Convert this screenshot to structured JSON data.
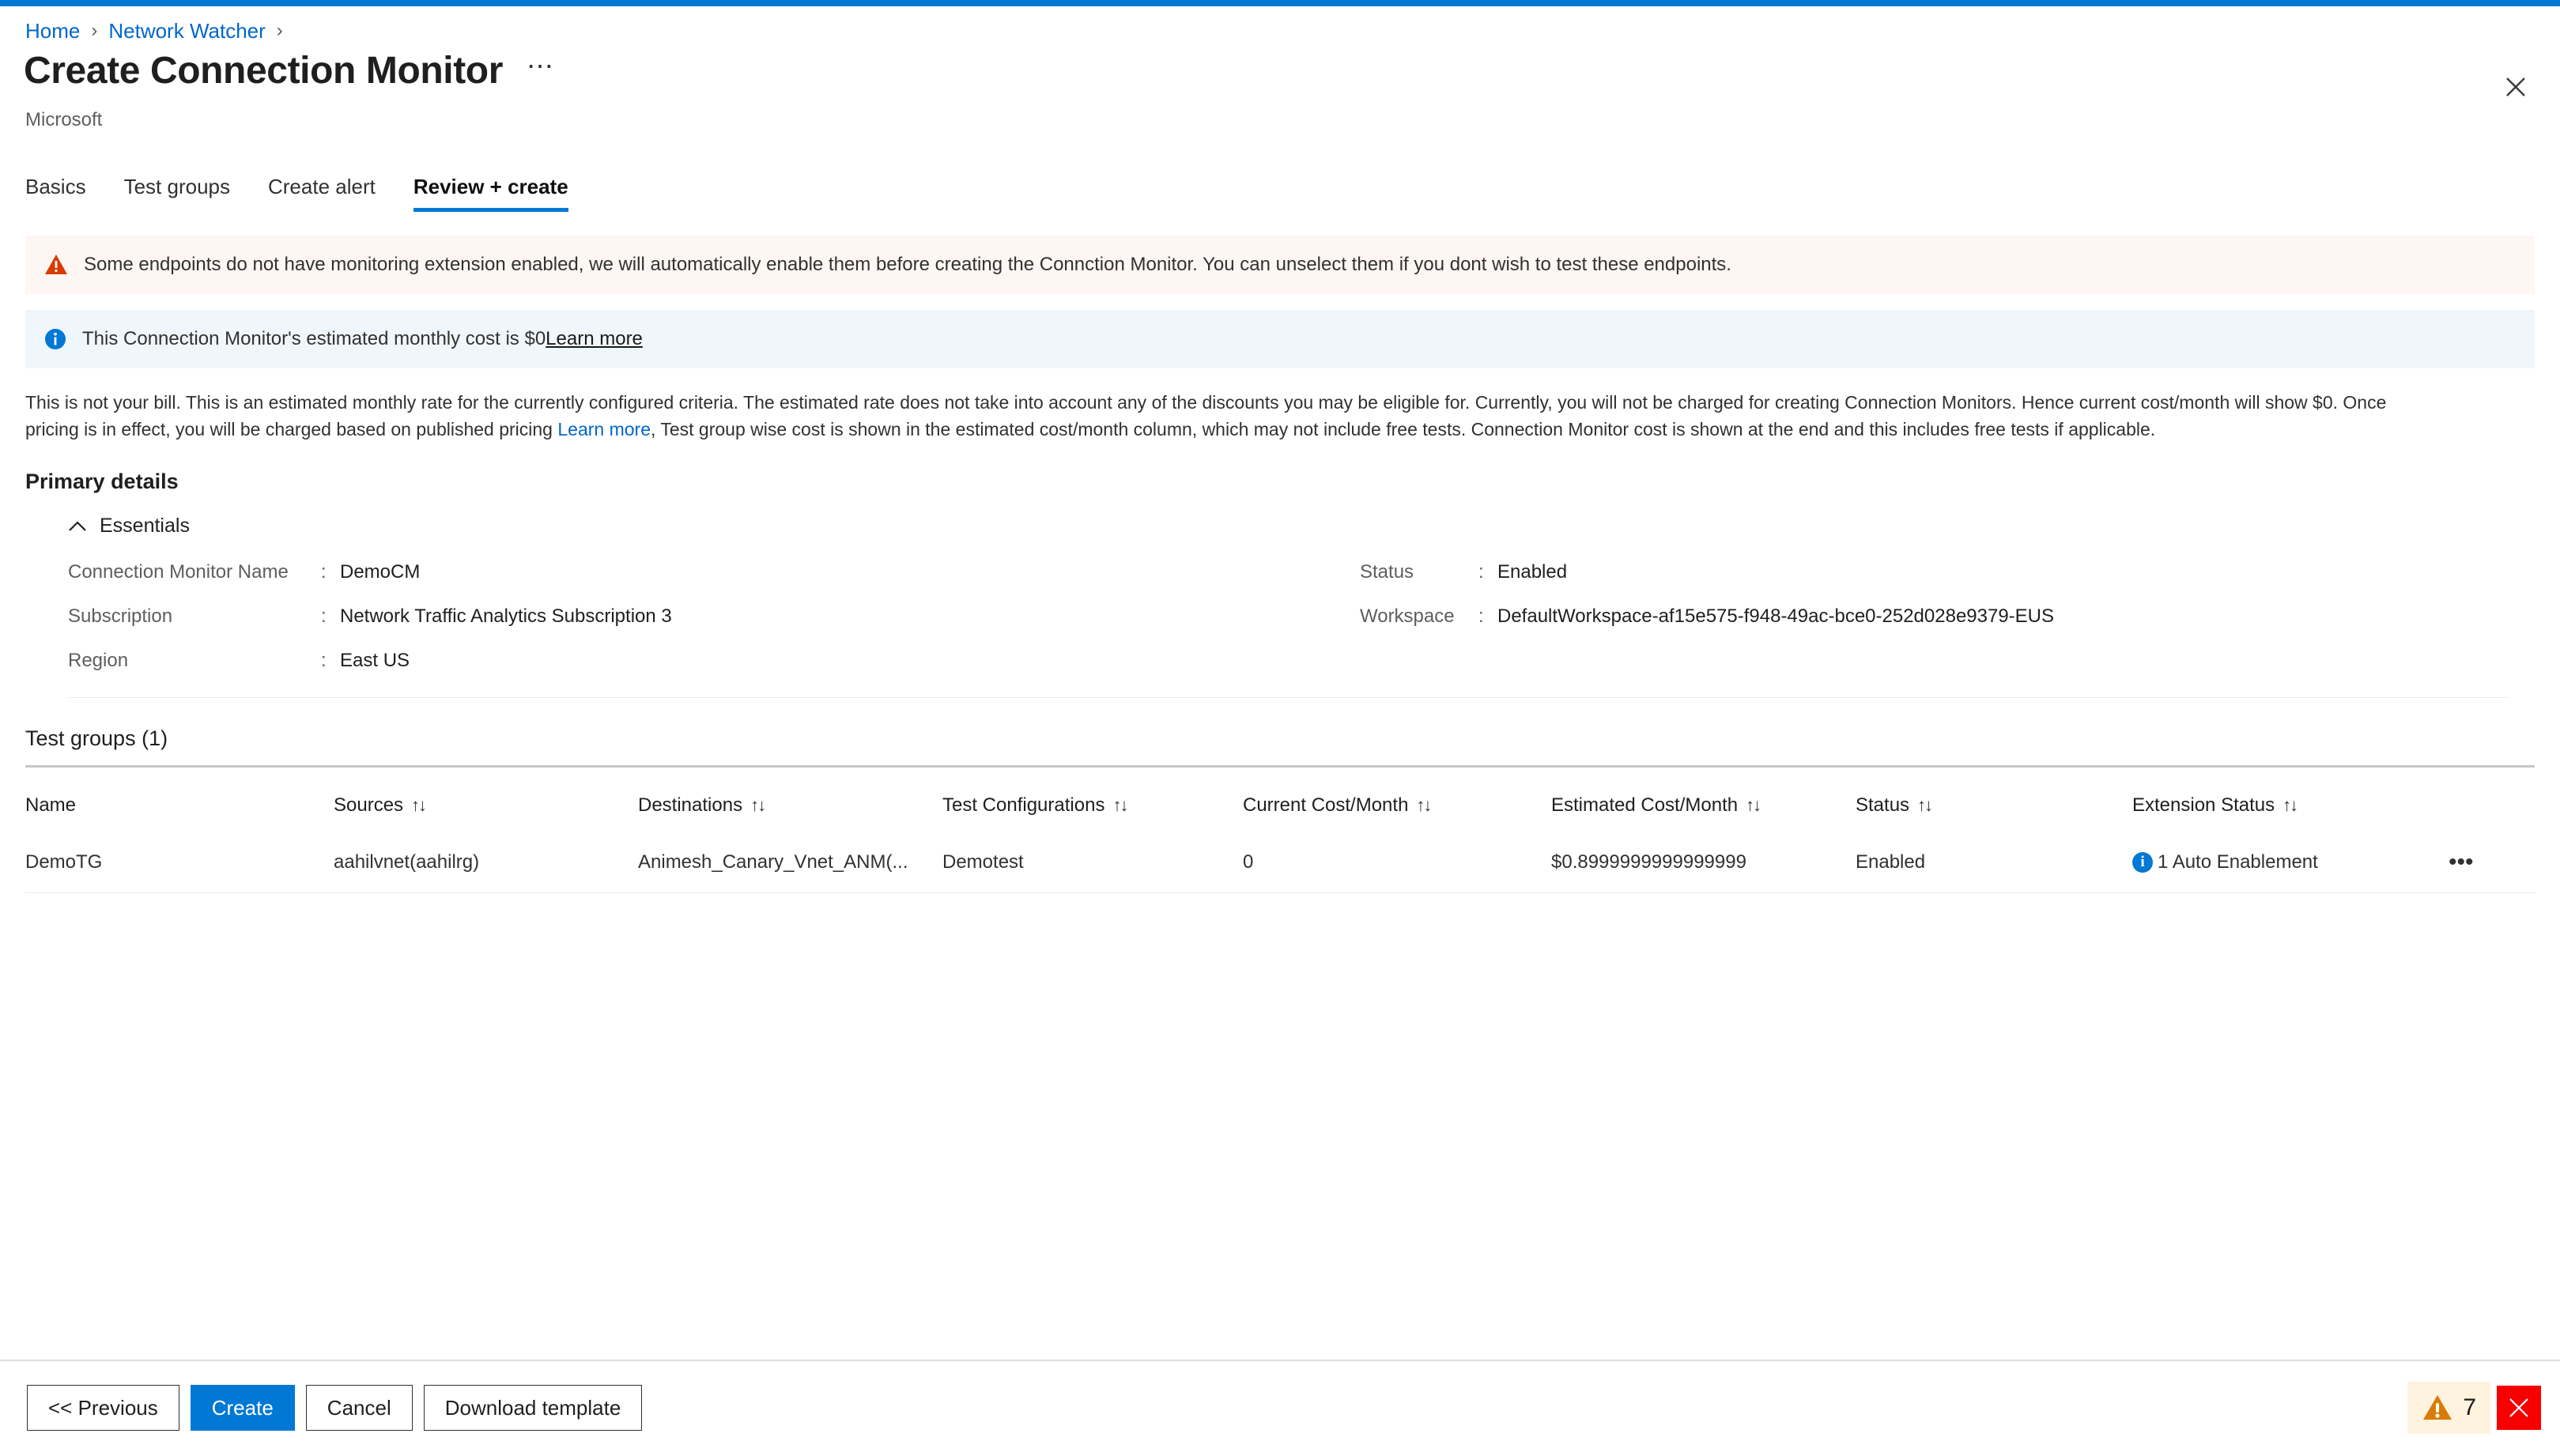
{
  "breadcrumb": {
    "items": [
      {
        "label": "Home"
      },
      {
        "label": "Network Watcher"
      }
    ],
    "separator": "›"
  },
  "header": {
    "title": "Create Connection Monitor",
    "subtitle": "Microsoft",
    "more_label": "⋯",
    "close_label": "close-icon"
  },
  "tabs": [
    {
      "label": "Basics",
      "active": false
    },
    {
      "label": "Test groups",
      "active": false
    },
    {
      "label": "Create alert",
      "active": false
    },
    {
      "label": "Review + create",
      "active": true
    }
  ],
  "banners": {
    "warning": {
      "icon": "warning-triangle-icon",
      "text": "Some endpoints do not have monitoring extension enabled, we will automatically enable them before creating the Connction Monitor. You can unselect them if you dont wish to test these endpoints."
    },
    "info": {
      "icon": "info-circle-icon",
      "text": "This Connection Monitor's estimated monthly cost is $0",
      "link_label": "Learn more"
    }
  },
  "disclaimer": {
    "part1": "This is not your bill. This is an estimated monthly rate for the currently configured criteria. The estimated rate does not take into account any of the discounts you may be eligible for. Currently, you will not be charged for creating Connection Monitors. Hence current cost/month will show $0. Once pricing is in effect, you will be charged based on published pricing ",
    "link_label": "Learn more",
    "part2": ", Test group wise cost is shown in the estimated cost/month column, which may not include free tests. Connection Monitor cost is shown at the end and this includes free tests if applicable."
  },
  "primary_details": {
    "heading": "Primary details",
    "essentials_label": "Essentials",
    "essentials_expanded": true,
    "left_rows": [
      {
        "label": "Connection Monitor Name",
        "colon": ":",
        "value": "DemoCM"
      },
      {
        "label": "Subscription",
        "colon": ":",
        "value": "Network Traffic Analytics Subscription 3"
      },
      {
        "label": "Region",
        "colon": ":",
        "value": "East US"
      }
    ],
    "right_rows": [
      {
        "label": "Status",
        "colon": ":",
        "value": "Enabled"
      },
      {
        "label": "Workspace",
        "colon": ":",
        "value": "DefaultWorkspace-af15e575-f948-49ac-bce0-252d028e9379-EUS"
      },
      {
        "label": "",
        "colon": "",
        "value": ""
      }
    ]
  },
  "test_groups": {
    "heading": "Test groups (1)",
    "sort_glyph": "↑↓",
    "columns": [
      {
        "label": "Name",
        "sortable": false
      },
      {
        "label": "Sources",
        "sortable": true
      },
      {
        "label": "Destinations",
        "sortable": true
      },
      {
        "label": "Test Configurations",
        "sortable": true
      },
      {
        "label": "Current Cost/Month",
        "sortable": true
      },
      {
        "label": "Estimated Cost/Month",
        "sortable": true
      },
      {
        "label": "Status",
        "sortable": true
      },
      {
        "label": "Extension Status",
        "sortable": true
      },
      {
        "label": "",
        "sortable": false
      }
    ],
    "rows": [
      {
        "name": "DemoTG",
        "sources": "aahilvnet(aahilrg)",
        "destinations": "Animesh_Canary_Vnet_ANM(...",
        "test_configurations": "Demotest",
        "current_cost": "0",
        "estimated_cost": "$0.8999999999999999",
        "status": "Enabled",
        "extension_status": "1 Auto Enablement",
        "extension_icon": "info-circle-icon",
        "menu_label": "•••"
      }
    ]
  },
  "footer": {
    "buttons": [
      {
        "label": "<< Previous",
        "style": "default"
      },
      {
        "label": "Create",
        "style": "primary"
      },
      {
        "label": "Cancel",
        "style": "default"
      },
      {
        "label": "Download template",
        "style": "default"
      }
    ],
    "notifications": {
      "warning_count": "7",
      "warning_icon": "warning-triangle-icon",
      "error_icon": "error-x-icon"
    }
  },
  "colors": {
    "accent": "#0078d4",
    "link": "#0066cc",
    "warning": "#d83b01",
    "warning_banner_bg": "#fdf6f3",
    "info_banner_bg": "#eff6fc",
    "error": "#f80000",
    "notif_warn_bg": "#fdf3df"
  }
}
